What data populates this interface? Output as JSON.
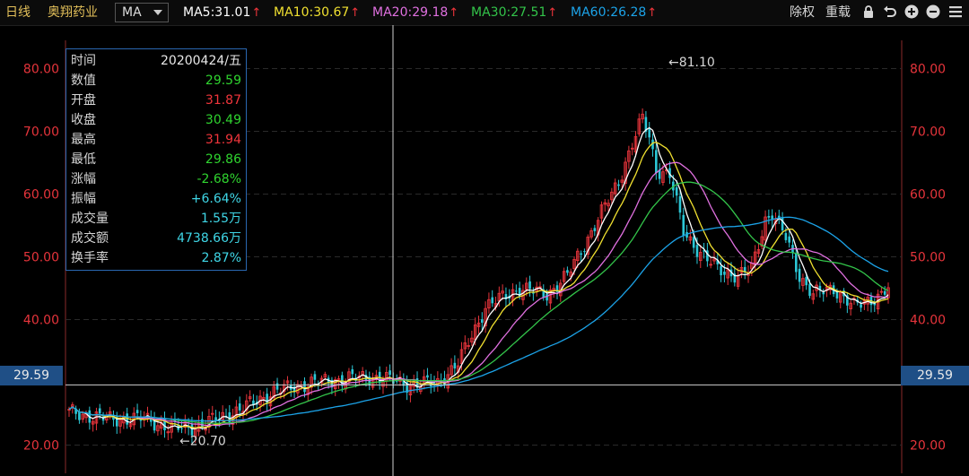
{
  "toolbar": {
    "period_label": "日线",
    "stock_name": "奥翔药业",
    "indicator_select": "MA",
    "ma_lines": [
      {
        "label": "MA5:31.01",
        "color": "#ffffff"
      },
      {
        "label": "MA10:30.67",
        "color": "#f0e030"
      },
      {
        "label": "MA20:29.18",
        "color": "#e070e0"
      },
      {
        "label": "MA30:27.51",
        "color": "#33c44a"
      },
      {
        "label": "MA60:26.28",
        "color": "#1ca3e8"
      }
    ],
    "up_arrow_glyph": "↑",
    "exright_label": "除权",
    "reload_label": "重载",
    "icons": [
      "lock-icon",
      "undo-icon",
      "zoom-in-icon",
      "zoom-out-icon",
      "menu-icon"
    ]
  },
  "axis": {
    "y_ticks": [
      "80.00",
      "70.00",
      "60.00",
      "50.00",
      "40.00",
      "20.00"
    ],
    "y_tick_values": [
      80,
      70,
      60,
      50,
      40,
      20
    ],
    "y_min": 15.5,
    "y_max": 84.5,
    "tick_color": "#e5343b",
    "grid_color": "#2a2a2a"
  },
  "crosshair": {
    "price_label": "29.59",
    "price_value": 29.59
  },
  "annotations": {
    "high_label": "←81.10",
    "high_value": 81.1,
    "low_label": "←20.70",
    "low_value": 20.7
  },
  "info_panel": {
    "rows": [
      {
        "label": "时间",
        "value": "20200424/五",
        "color": "#e8e8e8"
      },
      {
        "label": "数值",
        "value": "29.59",
        "color": "#2fd42f"
      },
      {
        "label": "开盘",
        "value": "31.87",
        "color": "#f0353b"
      },
      {
        "label": "收盘",
        "value": "30.49",
        "color": "#2fd42f"
      },
      {
        "label": "最高",
        "value": "31.94",
        "color": "#f0353b"
      },
      {
        "label": "最低",
        "value": "29.86",
        "color": "#2fd42f"
      },
      {
        "label": "涨幅",
        "value": "-2.68%",
        "color": "#2fd42f"
      },
      {
        "label": "振幅",
        "value": "+6.64%",
        "color": "#3fd6e6"
      },
      {
        "label": "成交量",
        "value": "1.55万",
        "color": "#3fd6e6"
      },
      {
        "label": "成交额",
        "value": "4738.66万",
        "color": "#3fd6e6"
      },
      {
        "label": "换手率",
        "value": "2.87%",
        "color": "#3fd6e6"
      }
    ]
  },
  "colors": {
    "up_candle": "#e5343b",
    "down_candle": "#2cc7d6",
    "text": "#d6d6d6",
    "border": "#2a67b0"
  }
}
